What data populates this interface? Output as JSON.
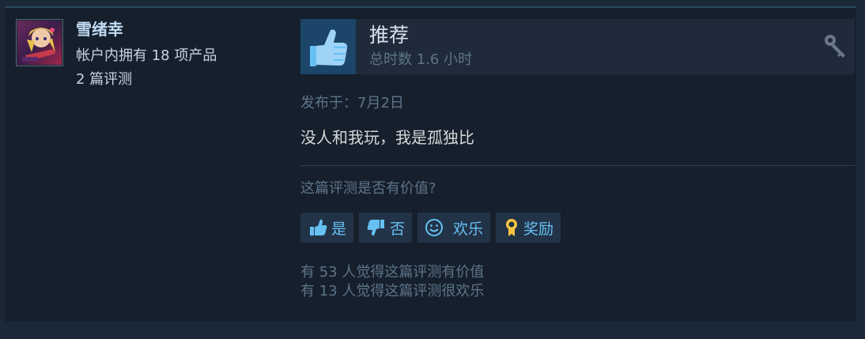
{
  "reviewer": {
    "name": "雪绪幸",
    "products_owned": "帐户内拥有 18 项产品",
    "review_count": "2 篇评测"
  },
  "review": {
    "verdict": "推荐",
    "hours": "总时数 1.6 小时",
    "posted": "发布于：7月2日",
    "text": "没人和我玩，我是孤独比"
  },
  "feedback": {
    "question": "这篇评测是否有价值?",
    "yes_label": "是",
    "no_label": "否",
    "funny_label": "欢乐",
    "award_label": "奖励",
    "helpful_stat": "有 53 人觉得这篇评测有价值",
    "funny_stat": "有 13 人觉得这篇评测很欢乐"
  },
  "colors": {
    "page_bg": "#1b2838",
    "card_bg": "#16202d",
    "accent": "#66c0f4",
    "thumb_bg": "#1b4569"
  },
  "icons": {
    "recommend": "thumbs-up-icon",
    "product_key": "key-icon",
    "yes": "thumbs-up-icon",
    "no": "thumbs-down-icon",
    "funny": "smiley-icon",
    "award": "award-medal-icon"
  }
}
